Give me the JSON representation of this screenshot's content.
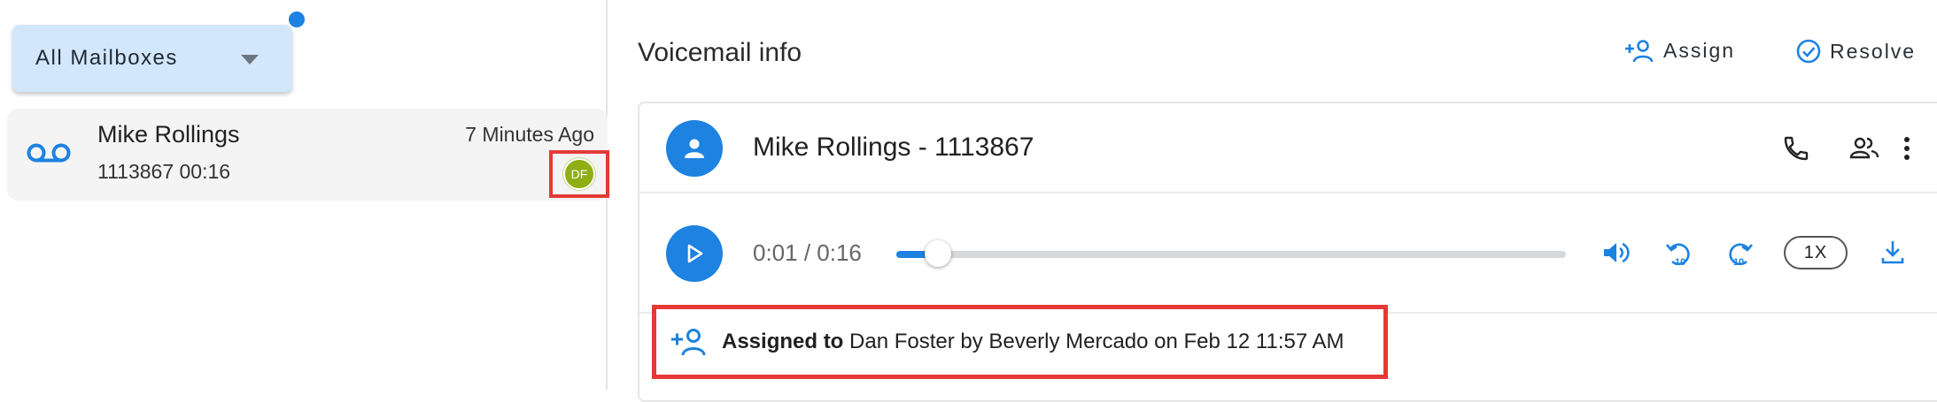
{
  "left": {
    "mailbox_selector": {
      "label": "All Mailboxes"
    },
    "voicemail_item": {
      "caller": "Mike Rollings",
      "details": "1113867 00:16",
      "time_ago": "7 Minutes Ago",
      "assignee_initials": "DF"
    }
  },
  "header": {
    "title": "Voicemail info",
    "assign_label": "Assign",
    "resolve_label": "Resolve"
  },
  "contact": {
    "title": "Mike Rollings - 1113867"
  },
  "player": {
    "time_display": "0:01 / 0:16",
    "progress_fraction": 0.0625,
    "speed_label": "1X"
  },
  "assignment": {
    "prefix": "Assigned to",
    "text": "Dan Foster by Beverly Mercado on Feb 12 11:57 AM"
  },
  "colors": {
    "accent": "#1d82e0",
    "dropdown_bg": "#d2e7fb",
    "highlight_border": "#e53935",
    "assignee_avatar": "#8fae13"
  }
}
